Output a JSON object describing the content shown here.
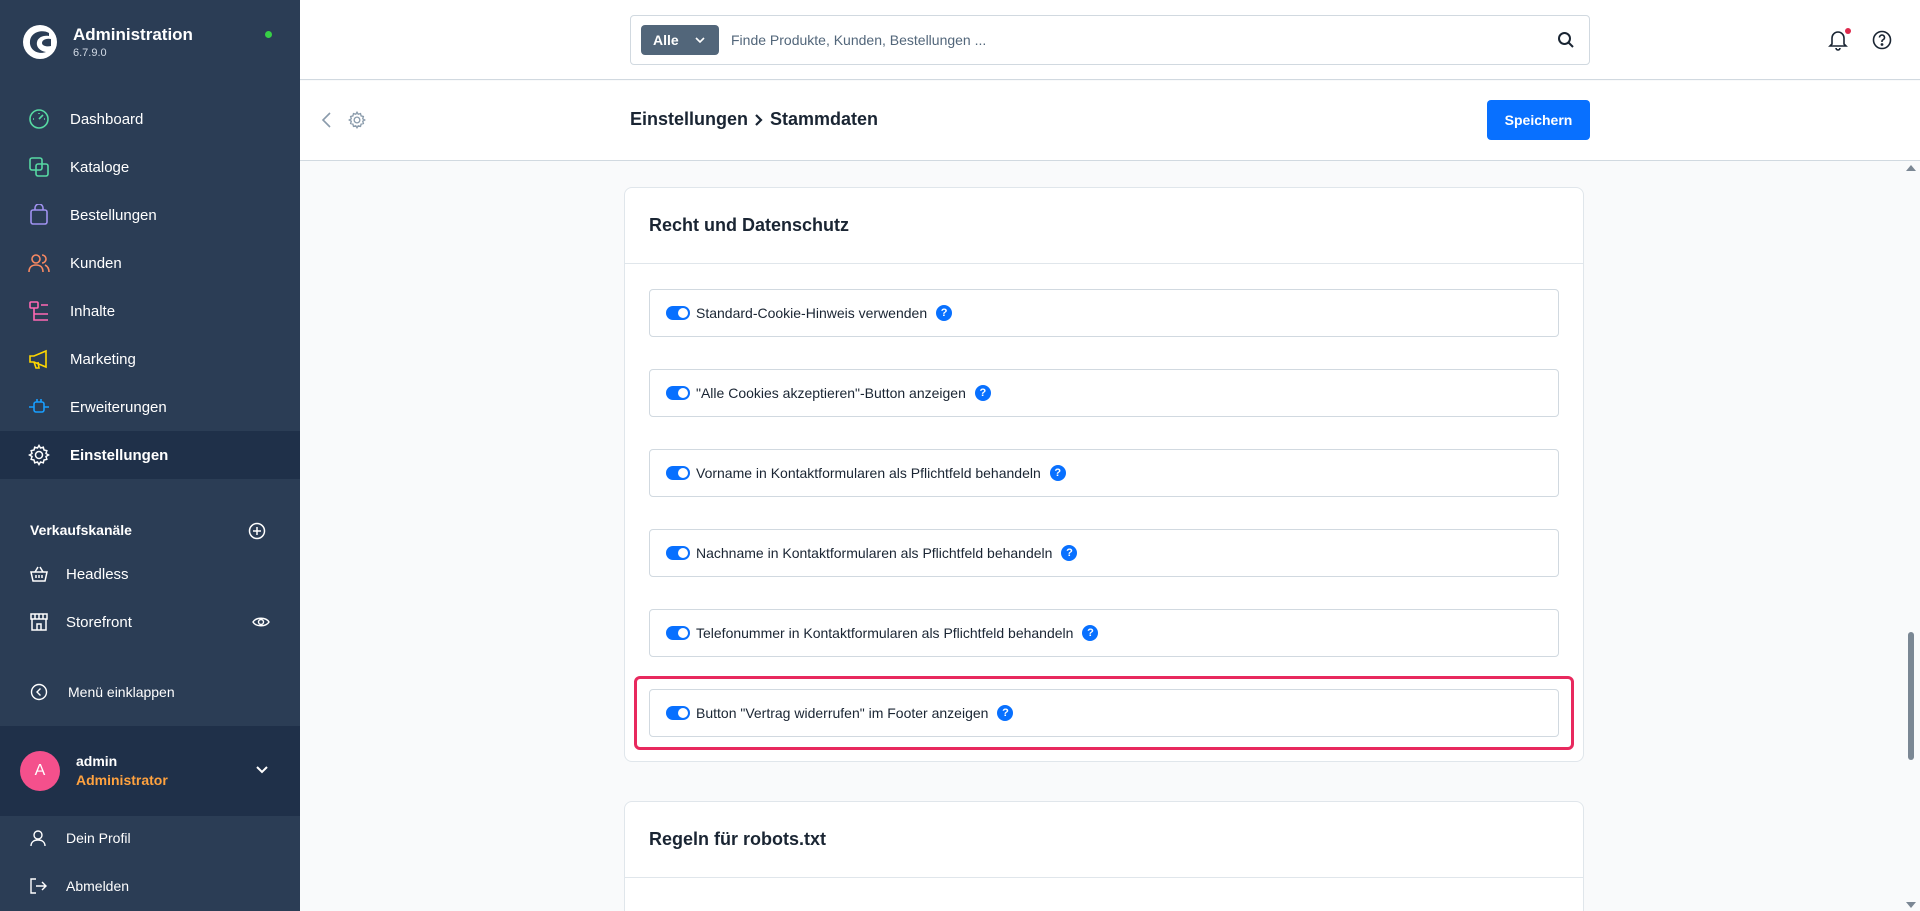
{
  "brand": {
    "title": "Administration",
    "version": "6.7.9.0"
  },
  "nav": [
    {
      "label": "Dashboard",
      "icon": "gauge-icon",
      "color": "#57d9a3"
    },
    {
      "label": "Kataloge",
      "icon": "products-icon",
      "color": "#57d9a3"
    },
    {
      "label": "Bestellungen",
      "icon": "shopping-bag-icon",
      "color": "#a092f0"
    },
    {
      "label": "Kunden",
      "icon": "users-icon",
      "color": "#f88962"
    },
    {
      "label": "Inhalte",
      "icon": "content-icon",
      "color": "#ff68b4"
    },
    {
      "label": "Marketing",
      "icon": "megaphone-icon",
      "color": "#ffd700"
    },
    {
      "label": "Erweiterungen",
      "icon": "plug-icon",
      "color": "#189eff"
    },
    {
      "label": "Einstellungen",
      "icon": "gear-icon",
      "color": "#ffffff",
      "active": true
    }
  ],
  "sales_channels": {
    "title": "Verkaufskanäle",
    "items": [
      {
        "label": "Headless",
        "icon": "basket-icon"
      },
      {
        "label": "Storefront",
        "icon": "storefront-icon"
      }
    ]
  },
  "collapse_label": "Menü einklappen",
  "user": {
    "initial": "A",
    "name": "admin",
    "role": "Administrator"
  },
  "footer": [
    {
      "label": "Dein Profil",
      "icon": "user-icon"
    },
    {
      "label": "Abmelden",
      "icon": "logout-icon"
    }
  ],
  "search": {
    "type_label": "Alle",
    "placeholder": "Finde Produkte, Kunden, Bestellungen ..."
  },
  "smartbar": {
    "crumb1": "Einstellungen",
    "crumb2": "Stammdaten",
    "save_label": "Speichern"
  },
  "cards": {
    "privacy": {
      "title": "Recht und Datenschutz",
      "toggles": [
        {
          "label": "Standard-Cookie-Hinweis verwenden",
          "enabled": true
        },
        {
          "label": "\"Alle Cookies akzeptieren\"-Button anzeigen",
          "enabled": true
        },
        {
          "label": "Vorname in Kontaktformularen als Pflichtfeld behandeln",
          "enabled": true
        },
        {
          "label": "Nachname in Kontaktformularen als Pflichtfeld behandeln",
          "enabled": true
        },
        {
          "label": "Telefonummer in Kontaktformularen als Pflichtfeld behandeln",
          "enabled": true
        },
        {
          "label": "Button \"Vertrag widerrufen\" im Footer anzeigen",
          "enabled": true
        }
      ]
    },
    "robots": {
      "title": "Regeln für robots.txt"
    }
  },
  "info_glyph": "?",
  "colors": {
    "sidebar": "#2b3d55",
    "accent": "#0870ff",
    "highlight": "#e8295e",
    "status_online": "#37d046"
  }
}
